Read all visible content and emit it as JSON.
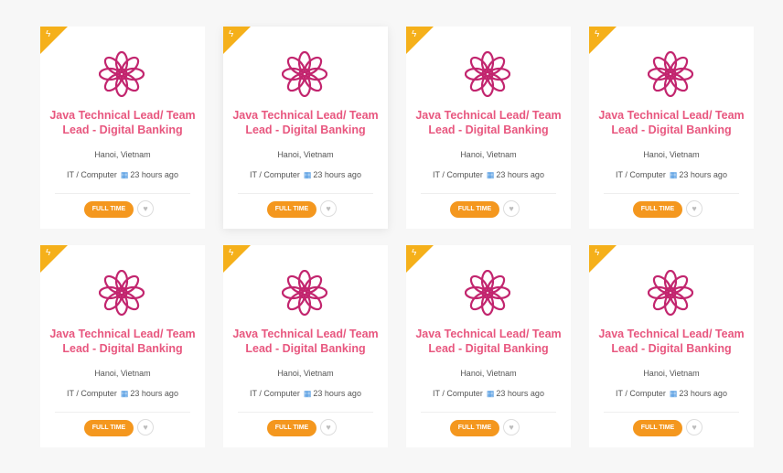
{
  "jobs": [
    {
      "title": "Java Technical Lead/ Team Lead - Digital Banking",
      "location": "Hanoi, Vietnam",
      "category": "IT / Computer",
      "posted": "23 hours ago",
      "type": "FULL TIME"
    },
    {
      "title": "Java Technical Lead/ Team Lead - Digital Banking",
      "location": "Hanoi, Vietnam",
      "category": "IT / Computer",
      "posted": "23 hours ago",
      "type": "FULL TIME"
    },
    {
      "title": "Java Technical Lead/ Team Lead - Digital Banking",
      "location": "Hanoi, Vietnam",
      "category": "IT / Computer",
      "posted": "23 hours ago",
      "type": "FULL TIME"
    },
    {
      "title": "Java Technical Lead/ Team Lead - Digital Banking",
      "location": "Hanoi, Vietnam",
      "category": "IT / Computer",
      "posted": "23 hours ago",
      "type": "FULL TIME"
    },
    {
      "title": "Java Technical Lead/ Team Lead - Digital Banking",
      "location": "Hanoi, Vietnam",
      "category": "IT / Computer",
      "posted": "23 hours ago",
      "type": "FULL TIME"
    },
    {
      "title": "Java Technical Lead/ Team Lead - Digital Banking",
      "location": "Hanoi, Vietnam",
      "category": "IT / Computer",
      "posted": "23 hours ago",
      "type": "FULL TIME"
    },
    {
      "title": "Java Technical Lead/ Team Lead - Digital Banking",
      "location": "Hanoi, Vietnam",
      "category": "IT / Computer",
      "posted": "23 hours ago",
      "type": "FULL TIME"
    },
    {
      "title": "Java Technical Lead/ Team Lead - Digital Banking",
      "location": "Hanoi, Vietnam",
      "category": "IT / Computer",
      "posted": "23 hours ago",
      "type": "FULL TIME"
    }
  ],
  "colors": {
    "accent": "#e8577f",
    "badge": "#f4971e",
    "flag": "#f5b01a",
    "calendar": "#3a8dde",
    "logo": "#c2256e"
  },
  "icons": {
    "flag": "lightning-icon",
    "logo": "flower-logo-icon",
    "date": "calendar-icon",
    "favorite": "heart-icon"
  }
}
